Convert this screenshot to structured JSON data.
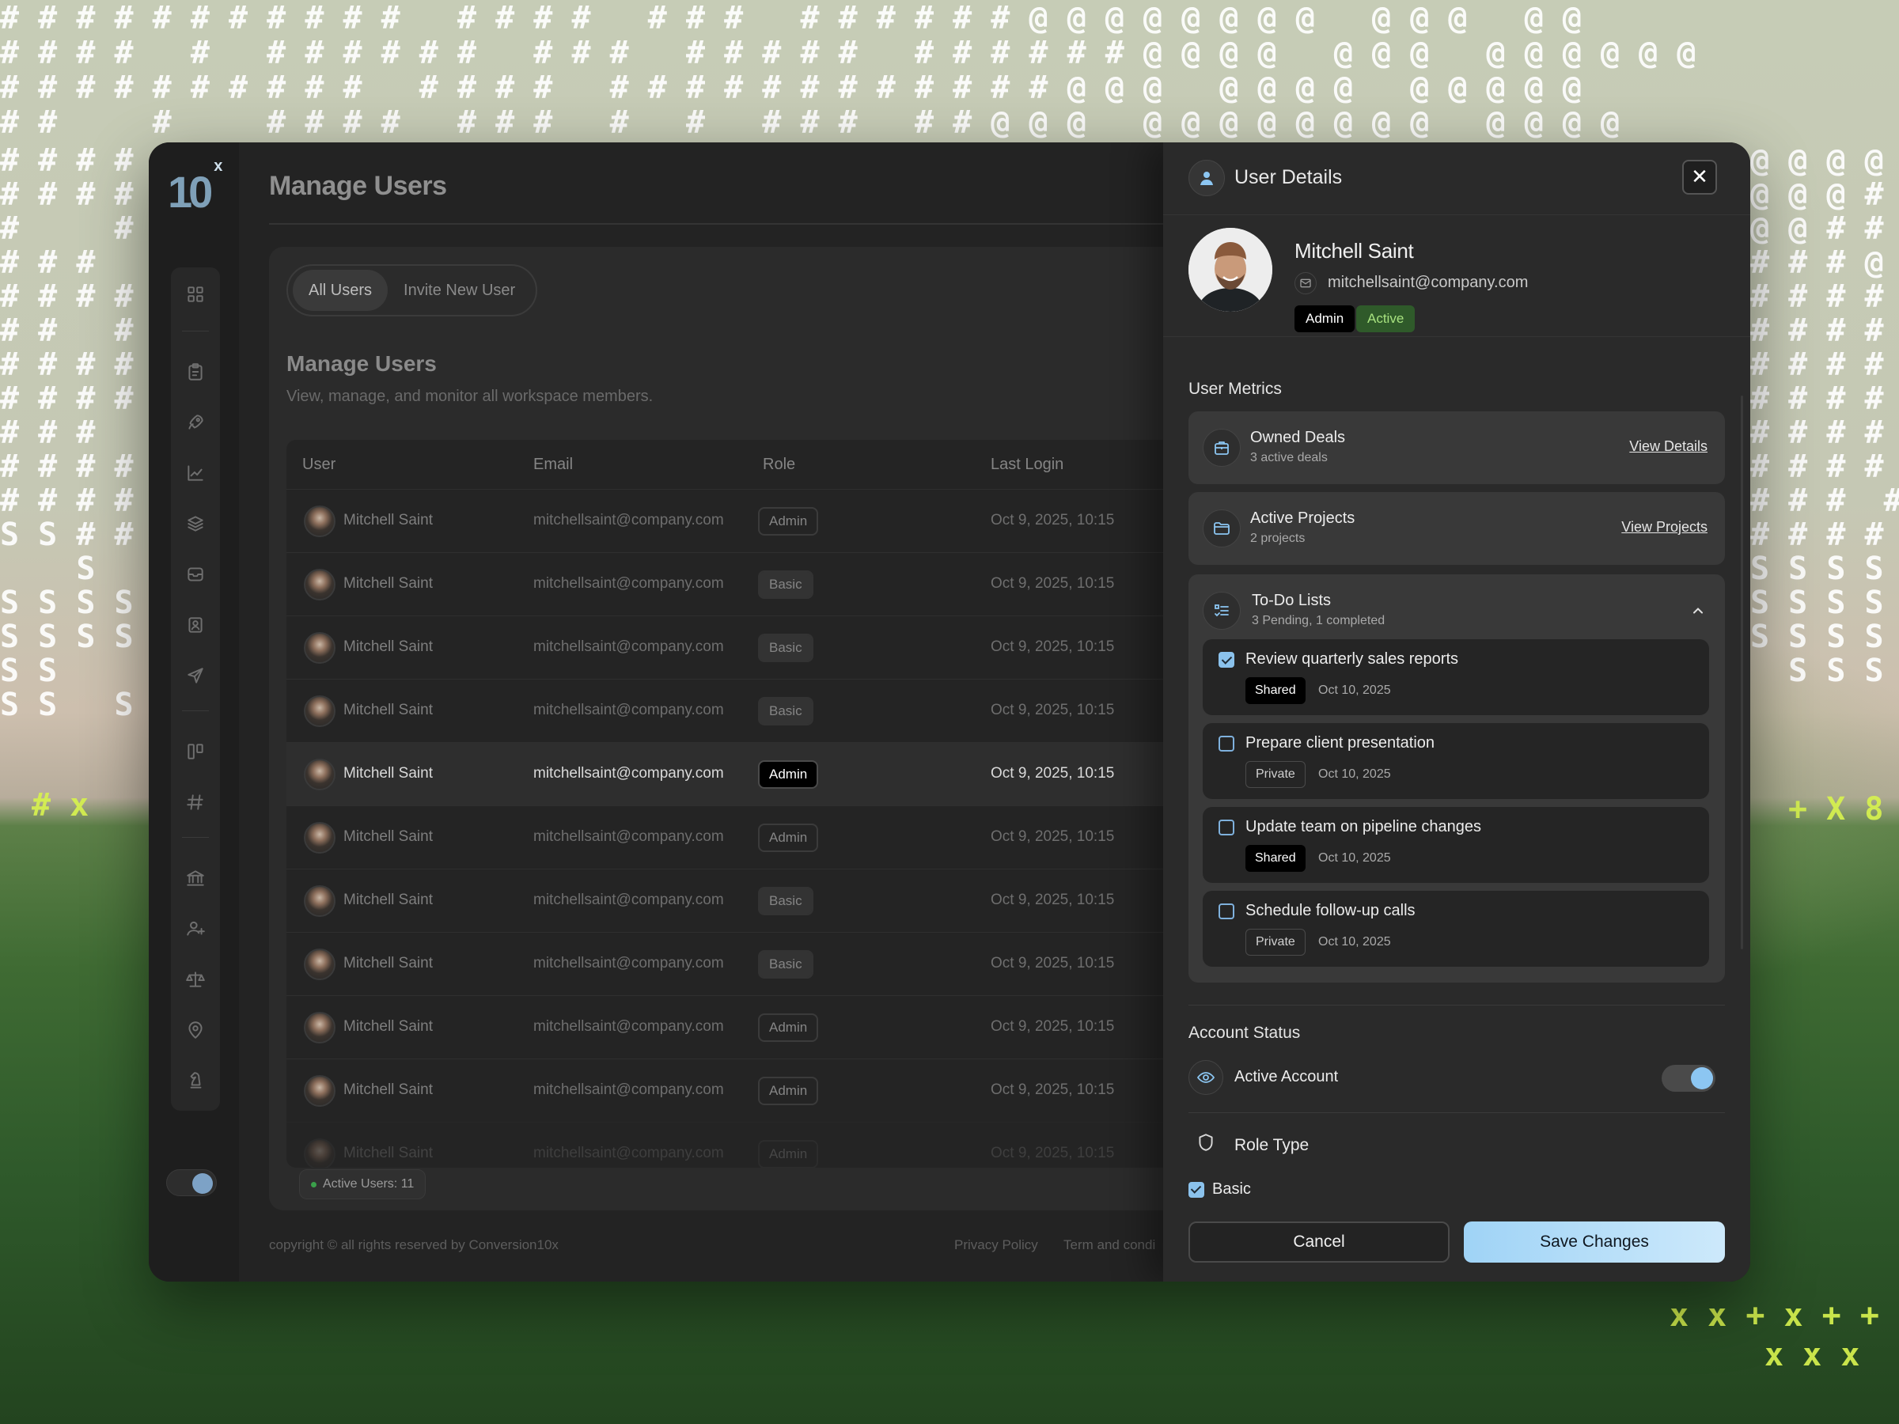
{
  "brand": {
    "logo": "10",
    "logo_sup": "x"
  },
  "page": {
    "title": "Manage Users"
  },
  "tabs": [
    {
      "label": "All Users"
    },
    {
      "label": "Invite New User"
    }
  ],
  "section": {
    "title": "Manage Users",
    "subtitle": "View, manage, and monitor all workspace members."
  },
  "table": {
    "headers": [
      "User",
      "Email",
      "Role",
      "Last Login"
    ],
    "rows": [
      {
        "name": "Mitchell Saint",
        "email": "mitchellsaint@company.com",
        "role": "Admin",
        "last_login": "Oct 9, 2025, 10:15"
      },
      {
        "name": "Mitchell Saint",
        "email": "mitchellsaint@company.com",
        "role": "Basic",
        "last_login": "Oct 9, 2025, 10:15"
      },
      {
        "name": "Mitchell Saint",
        "email": "mitchellsaint@company.com",
        "role": "Basic",
        "last_login": "Oct 9, 2025, 10:15"
      },
      {
        "name": "Mitchell Saint",
        "email": "mitchellsaint@company.com",
        "role": "Basic",
        "last_login": "Oct 9, 2025, 10:15"
      },
      {
        "name": "Mitchell Saint",
        "email": "mitchellsaint@company.com",
        "role": "Admin",
        "last_login": "Oct 9, 2025, 10:15"
      },
      {
        "name": "Mitchell Saint",
        "email": "mitchellsaint@company.com",
        "role": "Admin",
        "last_login": "Oct 9, 2025, 10:15"
      },
      {
        "name": "Mitchell Saint",
        "email": "mitchellsaint@company.com",
        "role": "Basic",
        "last_login": "Oct 9, 2025, 10:15"
      },
      {
        "name": "Mitchell Saint",
        "email": "mitchellsaint@company.com",
        "role": "Basic",
        "last_login": "Oct 9, 2025, 10:15"
      },
      {
        "name": "Mitchell Saint",
        "email": "mitchellsaint@company.com",
        "role": "Admin",
        "last_login": "Oct 9, 2025, 10:15"
      },
      {
        "name": "Mitchell Saint",
        "email": "mitchellsaint@company.com",
        "role": "Admin",
        "last_login": "Oct 9, 2025, 10:15"
      },
      {
        "name": "Mitchell Saint",
        "email": "mitchellsaint@company.com",
        "role": "Admin",
        "last_login": "Oct 9, 2025, 10:15"
      }
    ]
  },
  "active_users": "Active Users: 11",
  "footer": {
    "copyright": "copyright © all rights reserved by Conversion10x",
    "privacy": "Privacy Policy",
    "terms": "Term and condi"
  },
  "drawer": {
    "title": "User Details",
    "close": "✕",
    "user": {
      "name": "Mitchell Saint",
      "email": "mitchellsaint@company.com",
      "role_badge": "Admin",
      "status_badge": "Active"
    },
    "metrics_title": "User Metrics",
    "metrics": [
      {
        "title": "Owned Deals",
        "subtitle": "3 active deals",
        "link": "View Details",
        "icon": "briefcase-icon"
      },
      {
        "title": "Active Projects",
        "subtitle": "2 projects",
        "link": "View Projects",
        "icon": "folder-icon"
      }
    ],
    "todo": {
      "title": "To-Do Lists",
      "subtitle": "3 Pending, 1 completed",
      "items": [
        {
          "text": "Review quarterly sales reports",
          "tag": "Shared",
          "date": "Oct 10, 2025",
          "checked": true
        },
        {
          "text": "Prepare client presentation",
          "tag": "Private",
          "date": "Oct 10, 2025",
          "checked": false
        },
        {
          "text": "Update team on pipeline changes",
          "tag": "Shared",
          "date": "Oct 10, 2025",
          "checked": false
        },
        {
          "text": "Schedule follow-up calls",
          "tag": "Private",
          "date": "Oct 10, 2025",
          "checked": false
        }
      ]
    },
    "account_status_title": "Account Status",
    "active_account_label": "Active Account",
    "active_account_on": true,
    "role_type_title": "Role Type",
    "role_option": "Basic",
    "cancel": "Cancel",
    "save": "Save Changes"
  },
  "colors": {
    "accent": "#8bc2ec",
    "active_badge_bg": "#2f5a2a",
    "active_badge_text": "#a7e27f",
    "save_gradient_start": "#9fd3f6"
  }
}
